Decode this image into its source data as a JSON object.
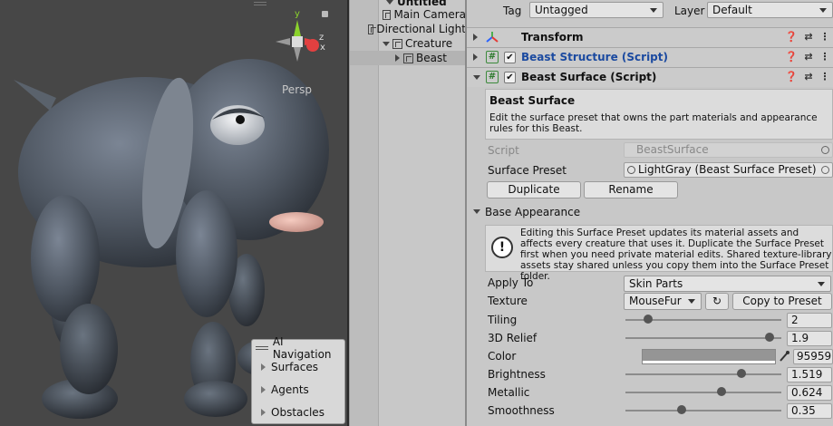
{
  "scene": {
    "persp_label": "Persp",
    "gizmo_labels": {
      "y": "y",
      "z": "z",
      "x": "x"
    }
  },
  "ai_nav": {
    "title": "AI Navigation",
    "items": [
      "Surfaces",
      "Agents",
      "Obstacles"
    ]
  },
  "hierarchy": {
    "rows": [
      {
        "label": "Untitled",
        "indent": 0,
        "expanded": true
      },
      {
        "label": "Main Camera",
        "indent": 1
      },
      {
        "label": "Directional Light",
        "indent": 1
      },
      {
        "label": "Creature",
        "indent": 1,
        "expanded": true
      },
      {
        "label": "Beast",
        "indent": 2,
        "selected": true
      }
    ]
  },
  "inspector": {
    "tag_label": "Tag",
    "tag_value": "Untagged",
    "layer_label": "Layer",
    "layer_value": "Default",
    "components": {
      "transform": "Transform",
      "beast_structure": "Beast Structure (Script)",
      "beast_surface": "Beast Surface (Script)"
    },
    "description_title": "Beast Surface",
    "description_text": "Edit the surface preset that owns the part materials and appearance rules for this Beast.",
    "script_label": "Script",
    "script_value": "BeastSurface",
    "surface_preset_label": "Surface Preset",
    "surface_preset_value": "LightGray (Beast Surface Preset)",
    "duplicate_label": "Duplicate",
    "rename_label": "Rename",
    "base_appearance_label": "Base Appearance",
    "help_text": "Editing this Surface Preset updates its material assets and affects every creature that uses it. Duplicate the Surface Preset first when you need private material edits. Shared texture-library assets stay shared unless you copy them into the Surface Preset folder.",
    "apply_to_label": "Apply To",
    "apply_to_value": "Skin Parts",
    "texture_label": "Texture",
    "texture_value": "MouseFur",
    "copy_to_preset_label": "Copy to Preset",
    "tiling_label": "Tiling",
    "tiling_value": "2",
    "tiling_fraction": 0.125,
    "relief_label": "3D Relief",
    "relief_value": "1.9",
    "relief_fraction": 0.95,
    "color_label": "Color",
    "color_value": "959595",
    "color_hex": "#959595",
    "brightness_label": "Brightness",
    "brightness_value": "1.519",
    "brightness_fraction": 0.76,
    "metallic_label": "Metallic",
    "metallic_value": "0.624",
    "metallic_fraction": 0.624,
    "smoothness_label": "Smoothness",
    "smoothness_value": "0.35",
    "smoothness_fraction": 0.35
  }
}
